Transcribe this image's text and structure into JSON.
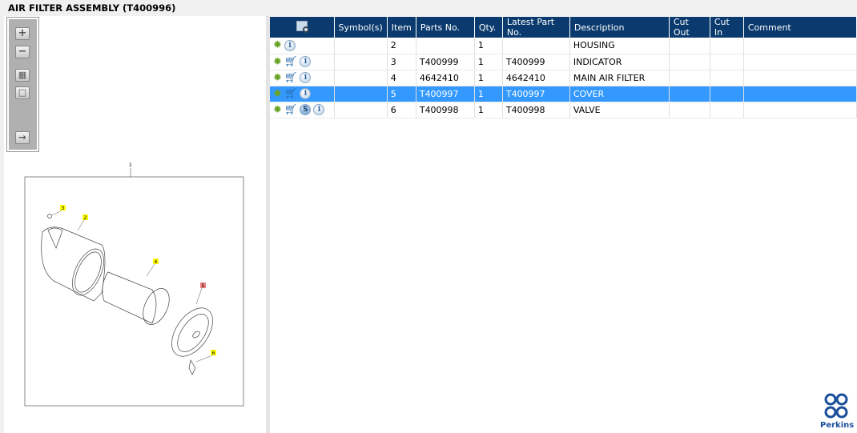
{
  "title": "AIR FILTER ASSEMBLY (T400996)",
  "toolbar": {
    "buttons": [
      {
        "name": "zoom-in",
        "glyph": "+"
      },
      {
        "name": "zoom-out",
        "glyph": "−"
      },
      {
        "name": "fit-all",
        "glyph": "▦"
      },
      {
        "name": "actual-size",
        "glyph": "□"
      },
      {
        "name": "toggle-panel",
        "glyph": "→"
      }
    ]
  },
  "diagram": {
    "callouts": [
      "1",
      "2",
      "3",
      "4",
      "5",
      "6"
    ]
  },
  "table": {
    "headers": [
      "",
      "Symbol(s)",
      "Item",
      "Parts No.",
      "Qty.",
      "Latest Part No.",
      "Description",
      "Cut Out",
      "Cut In",
      "Comment"
    ],
    "rows": [
      {
        "icons": [
          "gear",
          "info"
        ],
        "symbols": "",
        "item": "2",
        "part": "",
        "qty": "1",
        "latest": "",
        "desc": "HOUSING",
        "cutout": "",
        "cutin": "",
        "comment": ""
      },
      {
        "icons": [
          "gear",
          "cart",
          "info"
        ],
        "symbols": "",
        "item": "3",
        "part": "T400999",
        "qty": "1",
        "latest": "T400999",
        "desc": "INDICATOR",
        "cutout": "",
        "cutin": "",
        "comment": ""
      },
      {
        "icons": [
          "gear",
          "cart",
          "info"
        ],
        "symbols": "",
        "item": "4",
        "part": "4642410",
        "qty": "1",
        "latest": "4642410",
        "desc": "MAIN AIR FILTER",
        "cutout": "",
        "cutin": "",
        "comment": ""
      },
      {
        "icons": [
          "gear",
          "cart",
          "info"
        ],
        "symbols": "",
        "item": "5",
        "part": "T400997",
        "qty": "1",
        "latest": "T400997",
        "desc": "COVER",
        "cutout": "",
        "cutin": "",
        "comment": "",
        "selected": true
      },
      {
        "icons": [
          "gear",
          "cart",
          "s",
          "info"
        ],
        "symbols": "",
        "item": "6",
        "part": "T400998",
        "qty": "1",
        "latest": "T400998",
        "desc": "VALVE",
        "cutout": "",
        "cutin": "",
        "comment": ""
      }
    ]
  },
  "logo": {
    "text": "Perkins",
    "color": "#1a4f9c"
  },
  "colors": {
    "header": "#0b3b6e",
    "selected": "#3399ff"
  }
}
